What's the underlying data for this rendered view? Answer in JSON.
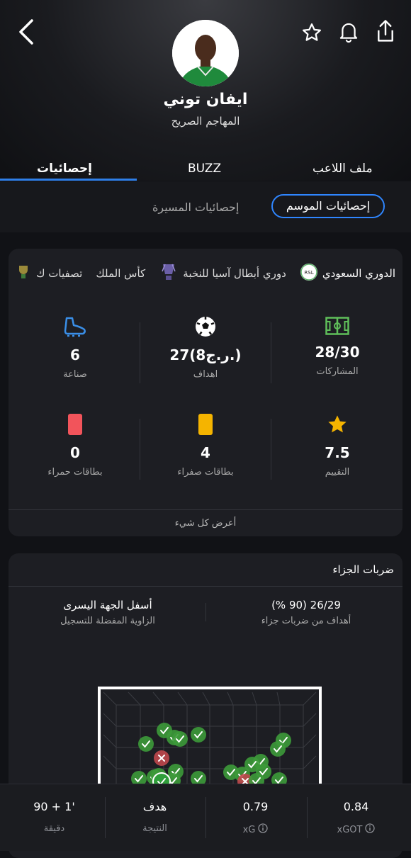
{
  "header": {
    "player_name": "ايفان توني",
    "position": "المهاجم الصريح",
    "icons": [
      "back-arrow-icon",
      "star-icon",
      "bell-icon",
      "share-icon"
    ]
  },
  "tabs": {
    "stats": "إحصائيات",
    "buzz": "BUZZ",
    "profile": "ملف اللاعب"
  },
  "subtabs": {
    "season": "إحصائيات الموسم",
    "career": "إحصائيات المسيرة"
  },
  "competitions": [
    "الدوري السعودي",
    "دوري أبطال آسيا للنخبة",
    "كأس الملك",
    "تصفيات ك"
  ],
  "stats": {
    "appearances": {
      "value": "28/30",
      "label": "المشاركات"
    },
    "goals": {
      "value": "27(8ر.ج.)",
      "label": "اهداف"
    },
    "assists": {
      "value": "6",
      "label": "صناعة"
    },
    "rating": {
      "value": "7.5",
      "label": "التقييم"
    },
    "yellow": {
      "value": "4",
      "label": "بطاقات صفراء"
    },
    "red": {
      "value": "0",
      "label": "بطاقات حمراء"
    },
    "show_all": "أعرض كل شيء"
  },
  "penalties": {
    "title": "ضربات الجزاء",
    "scored": {
      "value": "26/29 (90 %)",
      "label": "أهداف من ضربات جزاء"
    },
    "zone": {
      "value": "أسفل الجهة اليسرى",
      "label": "الزاوية المفضلة للتسجيل"
    }
  },
  "footer": {
    "minute": {
      "value": "90 + 1'",
      "label": "دقيقة"
    },
    "result": {
      "value": "هدف",
      "label": "النتيجة"
    },
    "xg": {
      "value": "0.79",
      "label": "xG"
    },
    "xgot": {
      "value": "0.84",
      "label": "xGOT"
    }
  },
  "colors": {
    "accent": "#2f86ff",
    "scored": "#3d9a3a",
    "missed": "#c0474c",
    "yellow": "#f5b400",
    "red": "#f2545b",
    "pitch": "#5fbf5a"
  }
}
